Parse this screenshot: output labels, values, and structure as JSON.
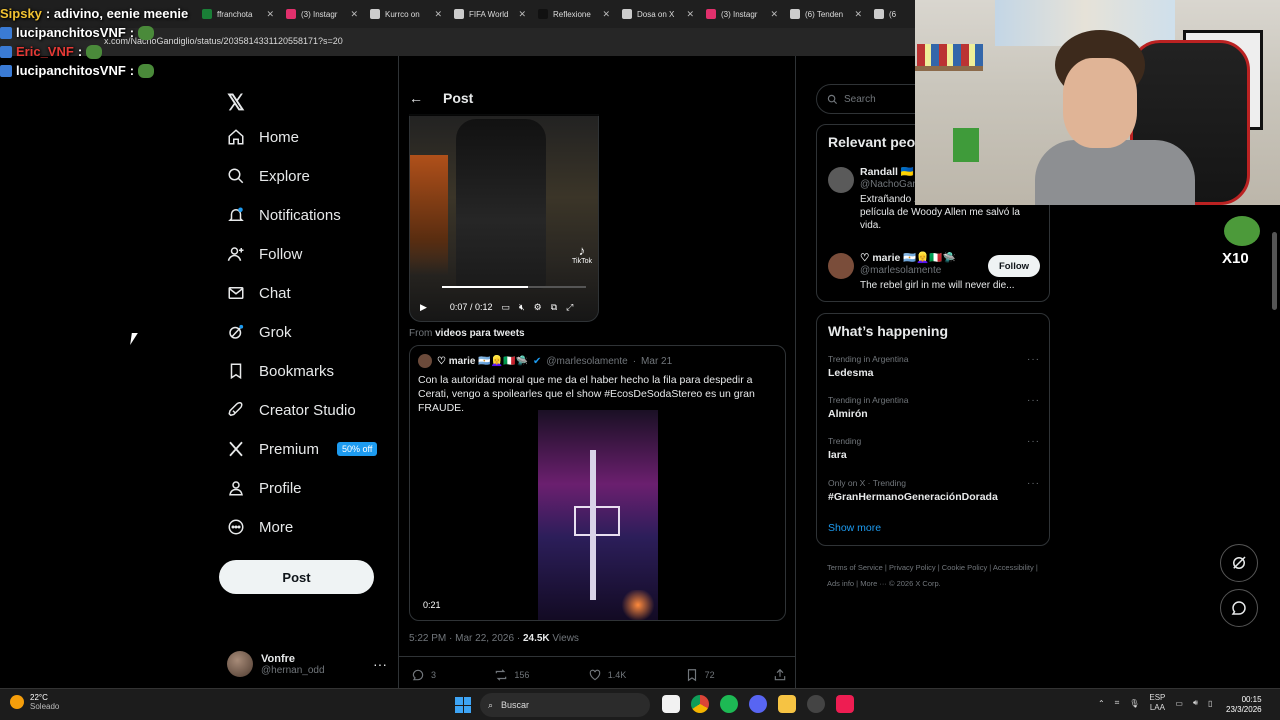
{
  "browser": {
    "tabs": [
      {
        "label": "ffranchota",
        "icon": "x-favicon",
        "color": "#1a7f37"
      },
      {
        "label": "(3) Instagr",
        "icon": "instagram-favicon",
        "color": "#e1306c"
      },
      {
        "label": "Kurrco on",
        "icon": "x-favicon",
        "color": "#cccccc"
      },
      {
        "label": "FIFA World",
        "icon": "x-favicon",
        "color": "#cccccc"
      },
      {
        "label": "Reflexione",
        "icon": "tiktok-favicon",
        "color": "#111111"
      },
      {
        "label": "Dosa on X",
        "icon": "x-favicon",
        "color": "#cccccc"
      },
      {
        "label": "(3) Instagr",
        "icon": "instagram-favicon",
        "color": "#e1306c"
      },
      {
        "label": "(6) Tenden",
        "icon": "x-favicon",
        "color": "#cccccc"
      },
      {
        "label": "(6",
        "icon": "x-favicon",
        "color": "#cccccc"
      }
    ],
    "url": "x.com/NachoGandiglio/status/2035814331120558171?s=20"
  },
  "chat_overlay": [
    {
      "user": "Sipsky",
      "message": ": adivino, eenie meenie",
      "user_color": "#f1c232"
    },
    {
      "user": "lucipanchitosVNF",
      "message": " :",
      "user_color": "#ffffff"
    },
    {
      "user": "Eric_VNF",
      "message": ":",
      "user_color": "#e53935"
    },
    {
      "user": "lucipanchitosVNF",
      "message": " :",
      "user_color": "#ffffff"
    }
  ],
  "nav": {
    "home": "Home",
    "explore": "Explore",
    "notifications": "Notifications",
    "follow": "Follow",
    "chat": "Chat",
    "grok": "Grok",
    "bookmarks": "Bookmarks",
    "creator_studio": "Creator Studio",
    "premium": "Premium",
    "premium_badge": "50% off",
    "profile": "Profile",
    "more": "More",
    "post_button": "Post",
    "account_name": "Vonfre",
    "account_handle": "@hernan_odd"
  },
  "main": {
    "header_title": "Post",
    "video": {
      "time": "0:07 / 0:12",
      "watermark": "TikTok",
      "progress": 0.6
    },
    "from_prefix": "From ",
    "from_source": "videos para tweets",
    "quote": {
      "name": "♡ marie 🇦🇷👱‍♀️🇮🇹🛸",
      "handle": "@marlesolamente",
      "date": "Mar 21",
      "text": "Con la autoridad moral que me da el haber hecho la fila para despedir a Cerati, vengo a spoilearles que el show #EcosDeSodaStereo es un gran FRAUDE.",
      "video_time": "0:21"
    },
    "timestamp": "5:22 PM · Mar 22, 2026 · ",
    "views_count": "24.5K",
    "views_label": " Views",
    "actions": {
      "replies": "3",
      "reposts": "156",
      "likes": "1.4K",
      "bookmarks": "72"
    }
  },
  "right": {
    "search_placeholder": "Search",
    "relevant_title": "Relevant peo",
    "people": [
      {
        "name": "Randall 🇺🇦",
        "handle": "@NachoGan",
        "bio": "Extrañando ... Maradona. Una película de Woody Allen me salvó la vida."
      },
      {
        "name": "♡ marie 🇦🇷👱‍♀️🇮🇹🛸",
        "handle": "@marlesolamente",
        "bio": "The rebel girl in me will never die...",
        "follow_label": "Follow"
      }
    ],
    "happening_title": "What’s happening",
    "trends": [
      {
        "context": "Trending in Argentina",
        "name": "Ledesma"
      },
      {
        "context": "Trending in Argentina",
        "name": "Almirón"
      },
      {
        "context": "Trending",
        "name": "Iara"
      },
      {
        "context": "Only on X · Trending",
        "name": "#GranHermanoGeneraciónDorada"
      }
    ],
    "show_more": "Show more",
    "footer": "Terms of Service  |  Privacy Policy  |  Cookie Policy  |  Accessibility  |  Ads info  |  More ···  © 2026 X Corp."
  },
  "overlay_badge": "X10",
  "taskbar": {
    "temp": "22°C",
    "condition": "Soleado",
    "search": "Buscar",
    "lang_top": "ESP",
    "lang_bottom": "LAA",
    "time": "00:15",
    "date": "23/3/2026"
  }
}
